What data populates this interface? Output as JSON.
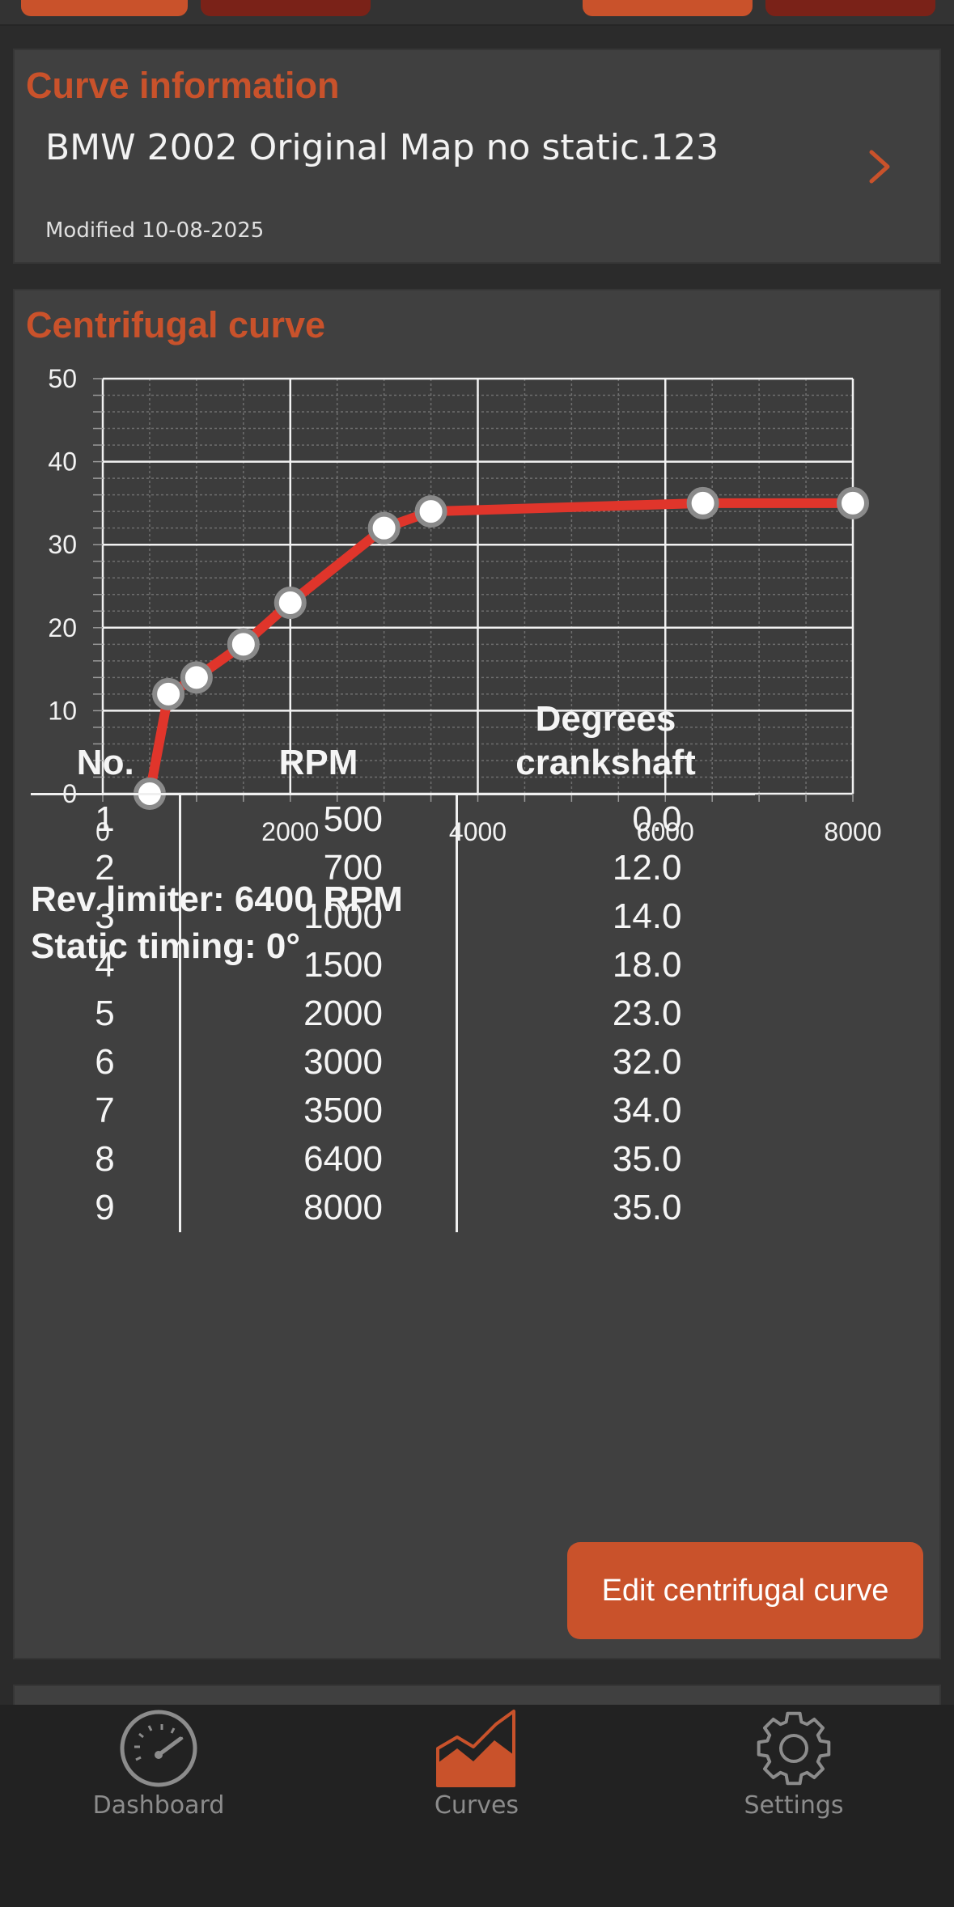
{
  "curve_info": {
    "title": "Curve information",
    "name": "BMW 2002 Original Map no static.123",
    "modified": "Modified 10-08-2025"
  },
  "centrifugal": {
    "title": "Centrifugal curve",
    "rev_limiter": "Rev limiter: 6400 RPM",
    "static_timing": "Static timing: 0°",
    "edit_button": "Edit centrifugal curve",
    "table": {
      "headers": [
        "No.",
        "RPM",
        "Degrees crankshaft"
      ],
      "rows": [
        [
          "1",
          "500",
          "0.0"
        ],
        [
          "2",
          "700",
          "12.0"
        ],
        [
          "3",
          "1000",
          "14.0"
        ],
        [
          "4",
          "1500",
          "18.0"
        ],
        [
          "5",
          "2000",
          "23.0"
        ],
        [
          "6",
          "3000",
          "32.0"
        ],
        [
          "7",
          "3500",
          "34.0"
        ],
        [
          "8",
          "6400",
          "35.0"
        ],
        [
          "9",
          "8000",
          "35.0"
        ]
      ]
    }
  },
  "chart_data": {
    "type": "line",
    "x": [
      500,
      700,
      1000,
      1500,
      2000,
      3000,
      3500,
      6400,
      8000
    ],
    "series": [
      {
        "values": [
          0,
          12,
          14,
          18,
          23,
          32,
          34,
          35,
          35
        ]
      }
    ],
    "xlim": [
      0,
      8000
    ],
    "ylim": [
      0,
      50
    ],
    "x_ticks": [
      "0",
      "2000",
      "4000",
      "6000",
      "8000"
    ],
    "y_ticks": [
      "0",
      "10",
      "20",
      "30",
      "40",
      "50"
    ],
    "grid": true,
    "line_color": "#e0352b",
    "marker_color": "#ffffff"
  },
  "tabbar": {
    "items": [
      {
        "label": "Dashboard",
        "icon": "gauge-icon"
      },
      {
        "label": "Curves",
        "icon": "curves-icon"
      },
      {
        "label": "Settings",
        "icon": "gear-icon"
      }
    ],
    "active_color": "#c9522b",
    "inactive_color": "#8c8c8c"
  }
}
